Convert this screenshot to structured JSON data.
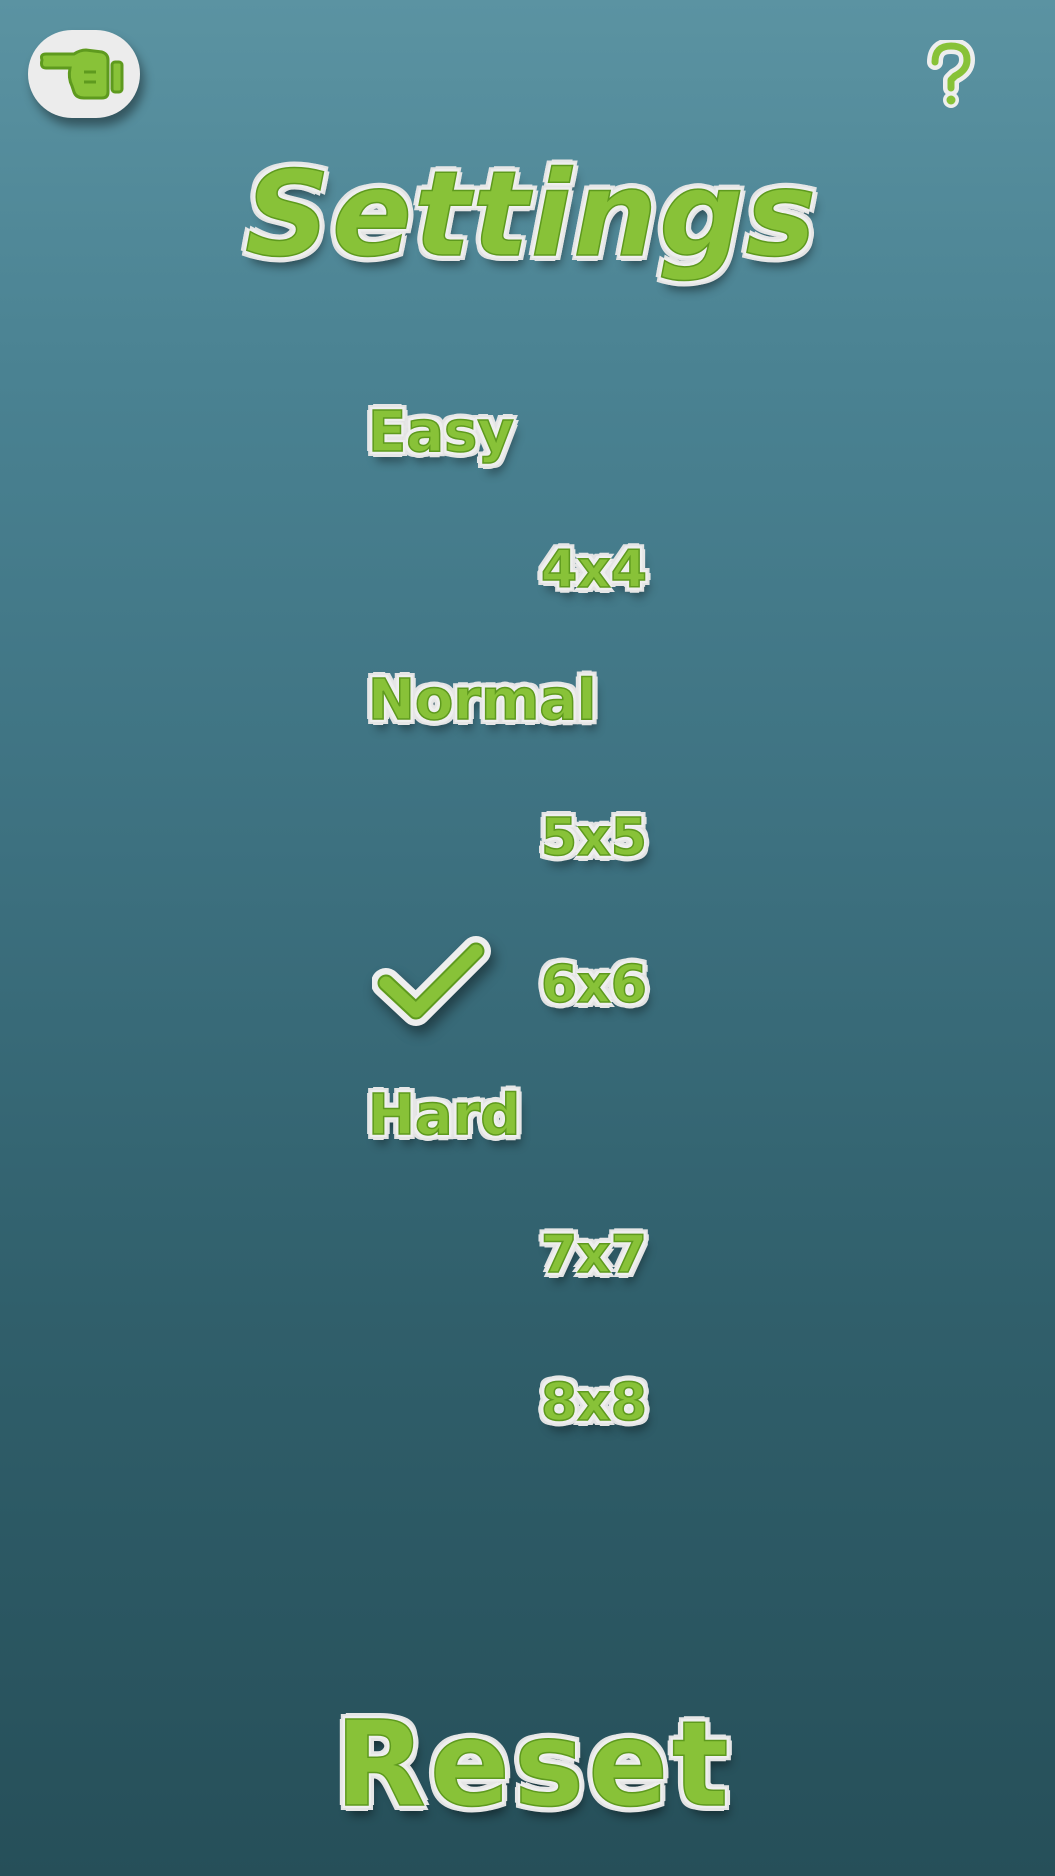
{
  "header": {
    "back_icon": "pointing-hand-icon",
    "help_icon": "question-mark-icon",
    "title": "Settings"
  },
  "colors": {
    "accent_green": "#88c238",
    "halo": "#eeeeee",
    "background_top": "#5b93a2",
    "background_bottom": "#264f59"
  },
  "settings": {
    "difficulties": [
      {
        "label": "Easy"
      },
      {
        "label": "Normal"
      },
      {
        "label": "Hard"
      }
    ],
    "sizes": [
      {
        "label": "4x4",
        "difficulty": "Easy",
        "selected": false
      },
      {
        "label": "5x5",
        "difficulty": "Normal",
        "selected": false
      },
      {
        "label": "6x6",
        "difficulty": "Normal",
        "selected": true
      },
      {
        "label": "7x7",
        "difficulty": "Hard",
        "selected": false
      },
      {
        "label": "8x8",
        "difficulty": "Hard",
        "selected": false
      }
    ],
    "selected_icon": "checkmark-icon"
  },
  "footer": {
    "reset_label": "Reset"
  }
}
